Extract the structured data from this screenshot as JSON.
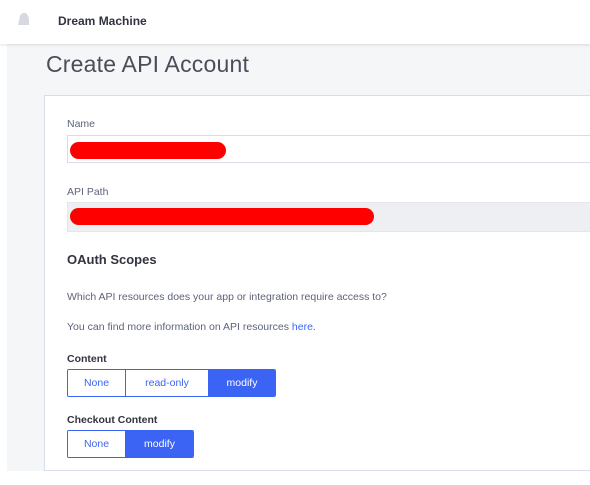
{
  "header": {
    "store_name": "Dream Machine",
    "logo_icon": "bell-logo-icon"
  },
  "page": {
    "title": "Create API Account"
  },
  "form": {
    "name_label": "Name",
    "name_value": "",
    "api_path_label": "API Path",
    "api_path_value": ""
  },
  "oauth": {
    "title": "OAuth Scopes",
    "description": "Which API resources does your app or integration require access to?",
    "more_info_prefix": "You can find more information on API resources ",
    "more_info_link": "here",
    "more_info_suffix": ".",
    "scopes": [
      {
        "label": "Content",
        "options": [
          "None",
          "read-only",
          "modify"
        ],
        "selected": "modify"
      },
      {
        "label": "Checkout Content",
        "options": [
          "None",
          "modify"
        ],
        "selected": "modify"
      }
    ]
  },
  "colors": {
    "accent": "#3c64f4",
    "redaction": "#ff0000",
    "canvas": "#f5f6f7"
  }
}
